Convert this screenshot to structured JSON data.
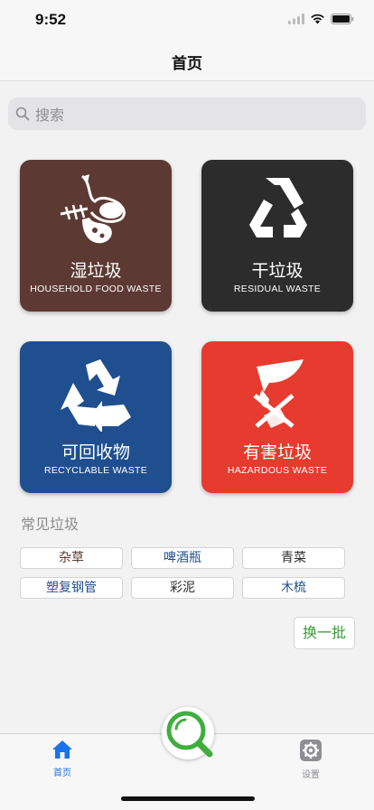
{
  "status_bar": {
    "time": "9:52"
  },
  "nav": {
    "title": "首页"
  },
  "search": {
    "placeholder": "搜索"
  },
  "categories": [
    {
      "name": "湿垃圾",
      "subtitle": "HOUSEHOLD FOOD WASTE",
      "color": "#5c3a33",
      "icon": "food-waste-icon"
    },
    {
      "name": "干垃圾",
      "subtitle": "RESIDUAL WASTE",
      "color": "#2c2c2c",
      "icon": "residual-waste-icon"
    },
    {
      "name": "可回收物",
      "subtitle": "RECYCLABLE WASTE",
      "color": "#1f4f8f",
      "icon": "recycle-icon"
    },
    {
      "name": "有害垃圾",
      "subtitle": "HAZARDOUS WASTE",
      "color": "#e63b2e",
      "icon": "hazardous-waste-icon"
    }
  ],
  "common": {
    "title": "常见垃圾",
    "items": [
      "杂草",
      "啤酒瓶",
      "青菜",
      "塑复钢管",
      "彩泥",
      "木梳"
    ],
    "item_colors": [
      "#5c3a33",
      "#1f4f8f",
      "#2c2c2c",
      "#1f4f8f",
      "#2c2c2c",
      "#1f4f8f"
    ],
    "refresh_label": "换一批"
  },
  "tab_bar": {
    "home_label": "首页",
    "settings_label": "设置",
    "active_color": "#1a73e8",
    "inactive_color": "#8e8e93",
    "scan_icon": "magnifier-icon",
    "scan_color": "#3fae3f"
  }
}
